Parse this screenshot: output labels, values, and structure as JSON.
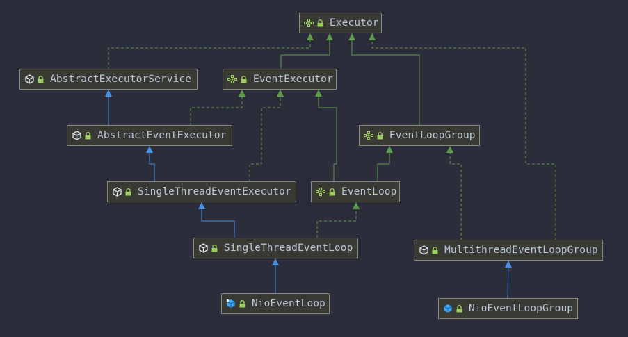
{
  "diagram": {
    "nodes": {
      "executor": {
        "label": "Executor",
        "kind": "interface",
        "icon": "interface-icon"
      },
      "abstract_executor_service": {
        "label": "AbstractExecutorService",
        "kind": "abstract-class",
        "icon": "abstract-class-icon"
      },
      "event_executor": {
        "label": "EventExecutor",
        "kind": "interface",
        "icon": "interface-icon"
      },
      "abstract_event_executor": {
        "label": "AbstractEventExecutor",
        "kind": "abstract-class",
        "icon": "abstract-class-icon"
      },
      "event_loop_group": {
        "label": "EventLoopGroup",
        "kind": "interface",
        "icon": "interface-icon"
      },
      "single_thread_event_executor": {
        "label": "SingleThreadEventExecutor",
        "kind": "abstract-class",
        "icon": "abstract-class-icon"
      },
      "event_loop": {
        "label": "EventLoop",
        "kind": "interface",
        "icon": "interface-icon"
      },
      "single_thread_event_loop": {
        "label": "SingleThreadEventLoop",
        "kind": "abstract-class",
        "icon": "abstract-class-icon"
      },
      "multithread_event_loop_group": {
        "label": "MultithreadEventLoopGroup",
        "kind": "abstract-class",
        "icon": "abstract-class-icon"
      },
      "nio_event_loop": {
        "label": "NioEventLoop",
        "kind": "class",
        "icon": "class-icon"
      },
      "nio_event_loop_group": {
        "label": "NioEventLoopGroup",
        "kind": "class",
        "icon": "class-icon"
      }
    },
    "edges": [
      {
        "from": "abstract_executor_service",
        "to": "executor",
        "type": "implements"
      },
      {
        "from": "event_executor",
        "to": "executor",
        "type": "extends-interface"
      },
      {
        "from": "event_loop_group",
        "to": "executor",
        "type": "extends-interface"
      },
      {
        "from": "multithread_event_loop_group",
        "to": "executor",
        "type": "implements"
      },
      {
        "from": "abstract_event_executor",
        "to": "abstract_executor_service",
        "type": "extends"
      },
      {
        "from": "abstract_event_executor",
        "to": "event_executor",
        "type": "implements"
      },
      {
        "from": "single_thread_event_executor",
        "to": "event_executor",
        "type": "implements"
      },
      {
        "from": "event_loop",
        "to": "event_executor",
        "type": "extends-interface"
      },
      {
        "from": "single_thread_event_executor",
        "to": "abstract_event_executor",
        "type": "extends"
      },
      {
        "from": "event_loop",
        "to": "event_loop_group",
        "type": "extends-interface"
      },
      {
        "from": "multithread_event_loop_group",
        "to": "event_loop_group",
        "type": "implements"
      },
      {
        "from": "single_thread_event_loop",
        "to": "event_loop",
        "type": "implements"
      },
      {
        "from": "single_thread_event_loop",
        "to": "single_thread_event_executor",
        "type": "extends"
      },
      {
        "from": "nio_event_loop",
        "to": "single_thread_event_loop",
        "type": "extends"
      },
      {
        "from": "nio_event_loop_group",
        "to": "multithread_event_loop_group",
        "type": "extends"
      }
    ],
    "colors": {
      "background": "#2b2d3a",
      "node_background": "#3a3a34",
      "node_border": "#8a8a80",
      "label": "#b8c6d9",
      "extends_edge": "#4a90e2",
      "interface_edge": "#5e9b4a",
      "lock": "#9ccf5f",
      "interface_icon": "#9ccf5f",
      "class_icon": "#3fa9f5"
    }
  }
}
